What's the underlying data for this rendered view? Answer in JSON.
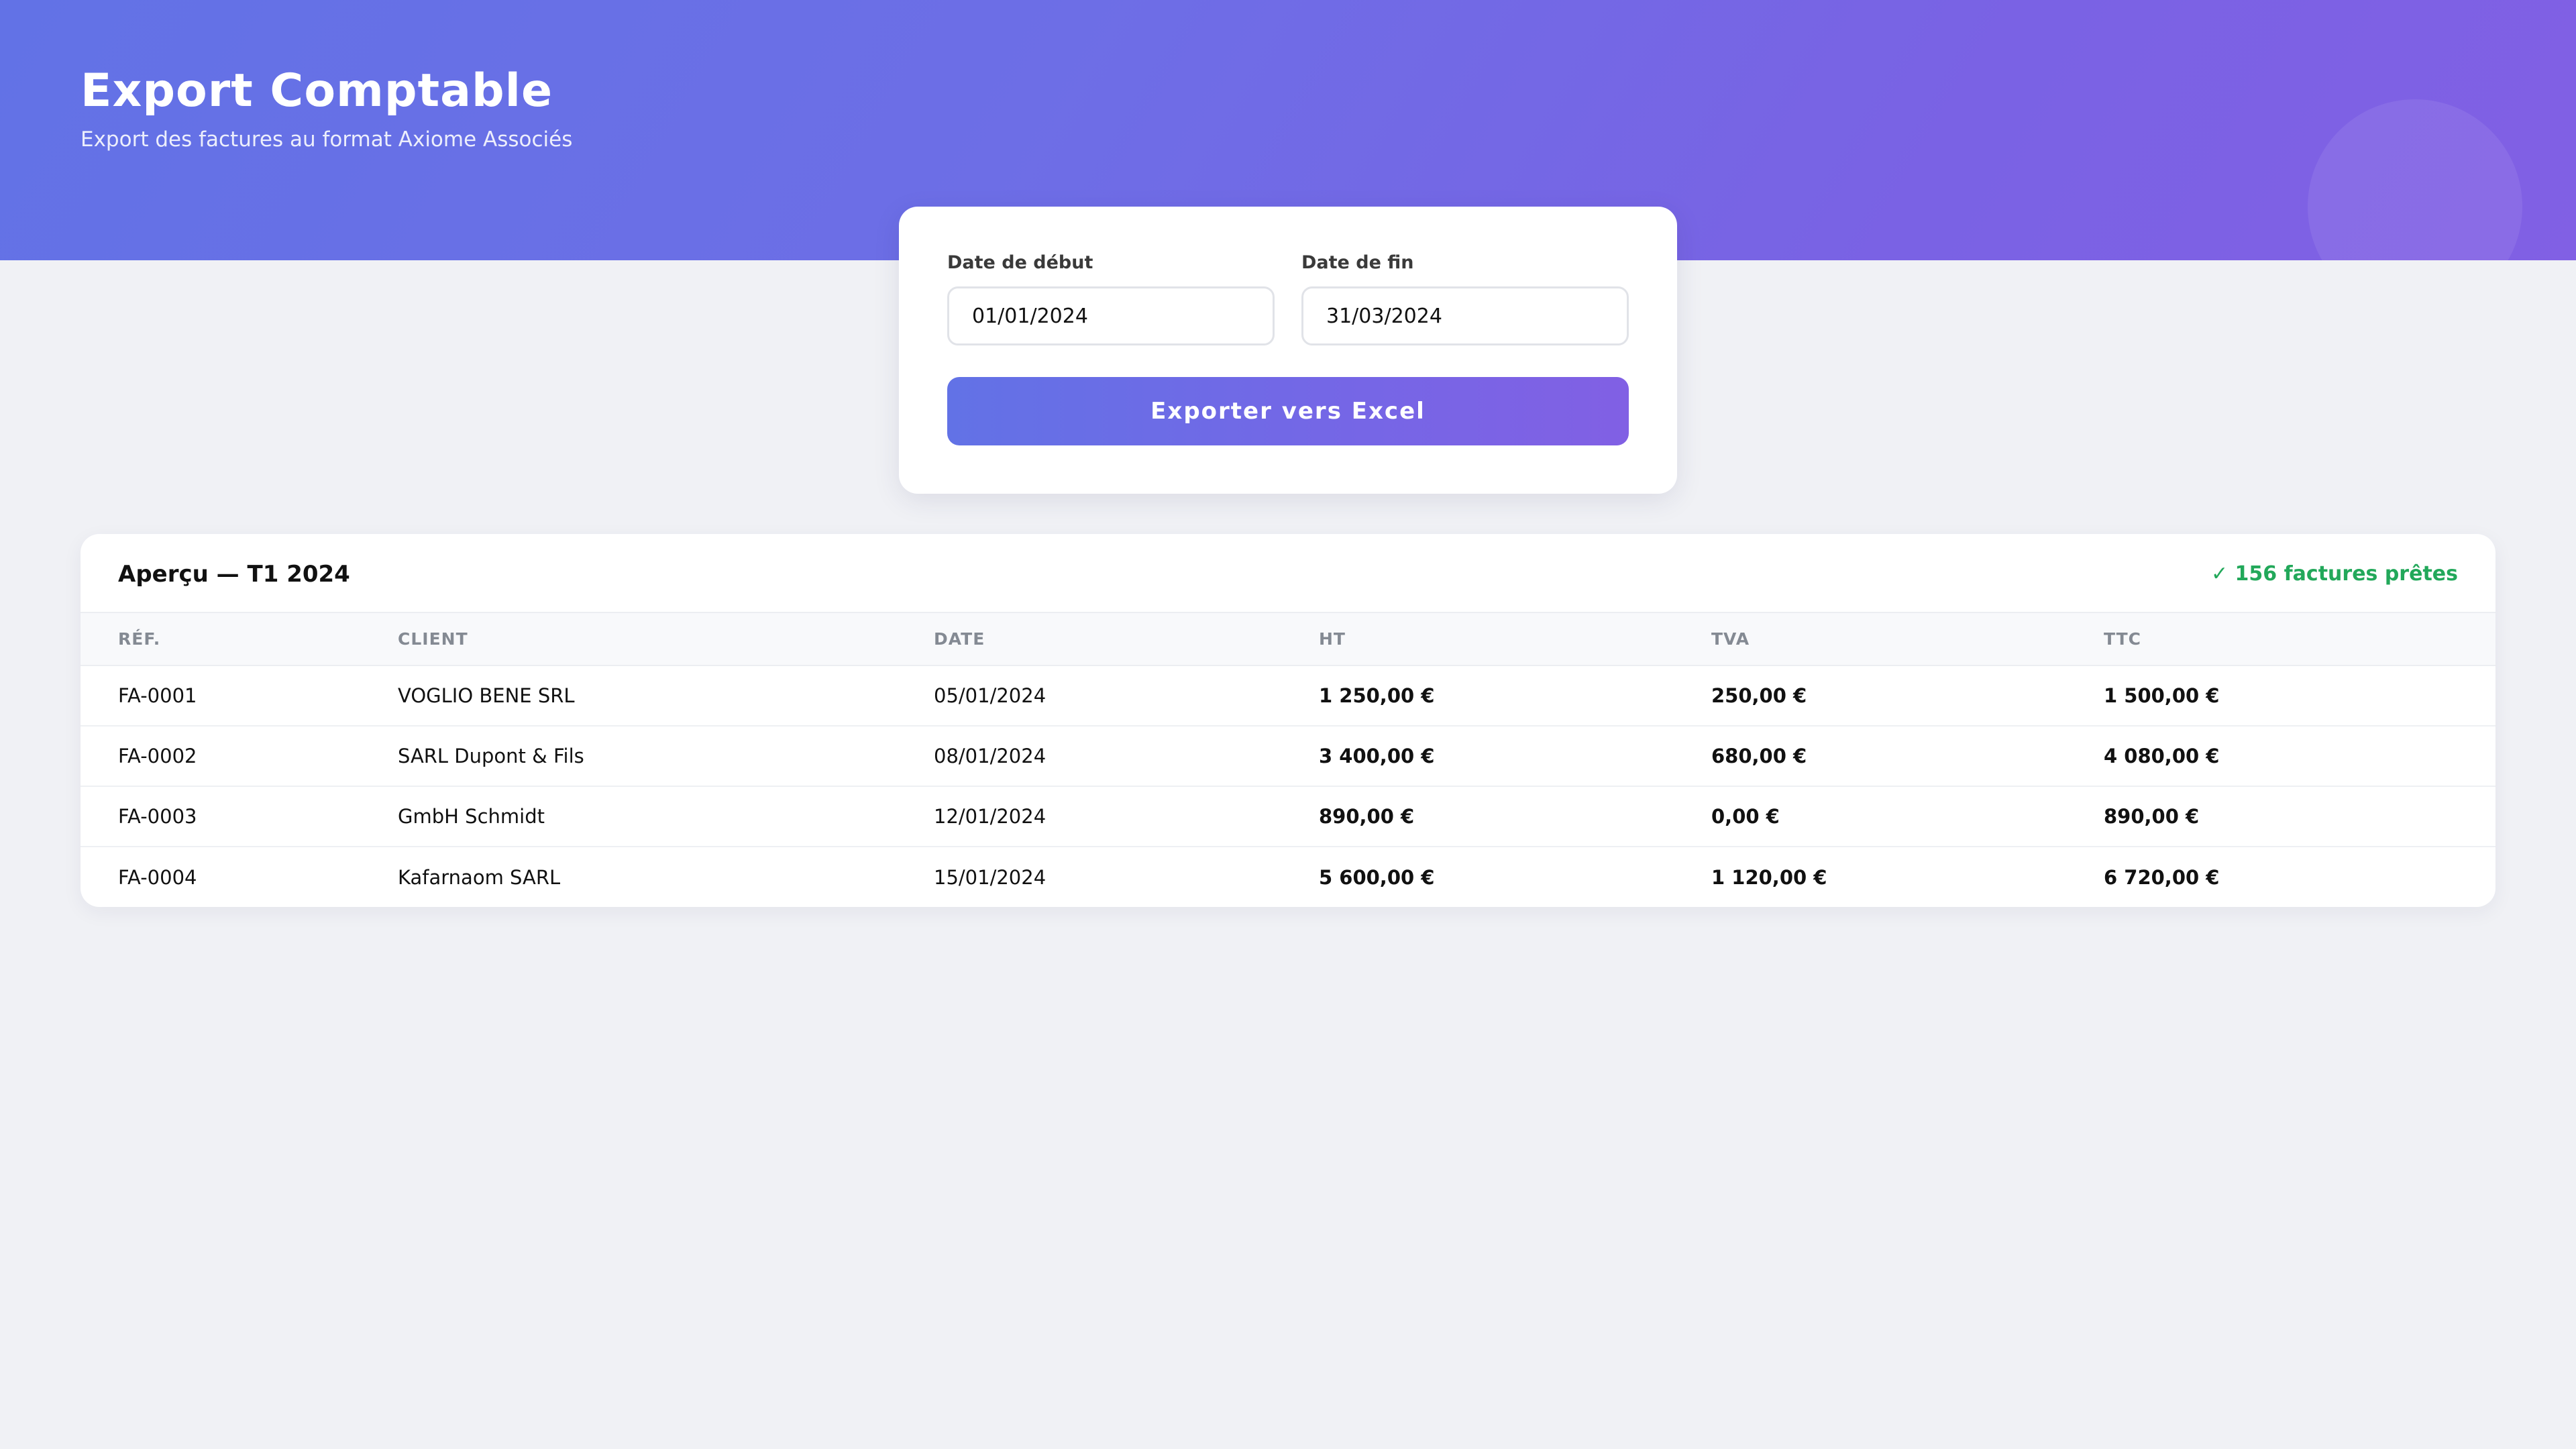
{
  "header": {
    "title": "Export Comptable",
    "subtitle": "Export des factures au format Axiome Associés"
  },
  "export_form": {
    "start_label": "Date de début",
    "start_value": "01/01/2024",
    "end_label": "Date de fin",
    "end_value": "31/03/2024",
    "button_label": "Exporter vers Excel"
  },
  "preview": {
    "title": "Aperçu — T1 2024",
    "status": "✓ 156 factures prêtes",
    "columns": [
      "RÉF.",
      "CLIENT",
      "DATE",
      "HT",
      "TVA",
      "TTC"
    ],
    "rows": [
      {
        "ref": "FA-0001",
        "client": "VOGLIO BENE SRL",
        "date": "05/01/2024",
        "ht": "1 250,00 €",
        "tva": "250,00 €",
        "ttc": "1 500,00 €"
      },
      {
        "ref": "FA-0002",
        "client": "SARL Dupont & Fils",
        "date": "08/01/2024",
        "ht": "3 400,00 €",
        "tva": "680,00 €",
        "ttc": "4 080,00 €"
      },
      {
        "ref": "FA-0003",
        "client": "GmbH Schmidt",
        "date": "12/01/2024",
        "ht": "890,00 €",
        "tva": "0,00 €",
        "ttc": "890,00 €"
      },
      {
        "ref": "FA-0004",
        "client": "Kafarnaom SARL",
        "date": "15/01/2024",
        "ht": "5 600,00 €",
        "tva": "1 120,00 €",
        "ttc": "6 720,00 €"
      }
    ]
  },
  "colors": {
    "accent_start": "#6272e6",
    "accent_end": "#8160e4",
    "success": "#22a85a",
    "background": "#f0f1f5"
  }
}
